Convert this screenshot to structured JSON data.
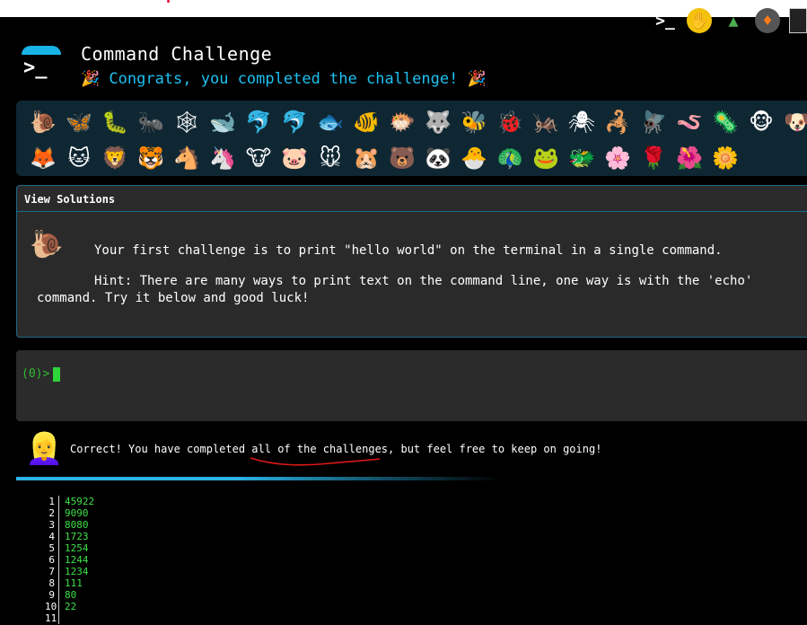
{
  "header": {
    "title": "Command Challenge",
    "subtitle": "🎉 Congrats, you completed the challenge! 🎉"
  },
  "top_icons": [
    "terminal-icon",
    "hand-icon",
    "tree-icon",
    "flame-icon",
    "image-icon"
  ],
  "emoji_rows": [
    [
      "🐌",
      "🦋",
      "🐛",
      "🐜",
      "🕸",
      "🐋",
      "🐬",
      "🐬",
      "🐟",
      "🐠",
      "🐡",
      "🐺",
      "🐝",
      "🐞",
      "🦗",
      "🕷",
      "🦂",
      "🪰",
      "🪱",
      "🦠",
      "🐵",
      "🐶"
    ],
    [
      "🦊",
      "🐱",
      "🦁",
      "🐯",
      "🐴",
      "🦄",
      "🐮",
      "🐷",
      "🐭",
      "🐹",
      "🐻",
      "🐼",
      "🐣",
      "🦚",
      "🐸",
      "🐲",
      "🌸",
      "🌹",
      "🌺",
      "🌼"
    ]
  ],
  "solutions": {
    "title": "View Solutions",
    "icon": "🐌",
    "challenge": "Your first challenge is to print \"hello world\" on the terminal in a single command.",
    "hint": "Hint: There are many ways to print text on the command line, one way is with the 'echo' command. Try it below and good luck!"
  },
  "terminal": {
    "prompt": "(0)>"
  },
  "result": {
    "avatar": "👱‍♀️",
    "message_before": "Correct! You have completed ",
    "message_emph": "all of the challenges",
    "message_after": ", but feel free to keep on going!"
  },
  "history": [
    {
      "n": "1",
      "v": "45922"
    },
    {
      "n": "2",
      "v": "9090"
    },
    {
      "n": "3",
      "v": "8080"
    },
    {
      "n": "4",
      "v": "1723"
    },
    {
      "n": "5",
      "v": "1254"
    },
    {
      "n": "6",
      "v": "1244"
    },
    {
      "n": "7",
      "v": "1234"
    },
    {
      "n": "8",
      "v": "111"
    },
    {
      "n": "9",
      "v": "80"
    },
    {
      "n": "10",
      "v": "22"
    },
    {
      "n": "11",
      "v": ""
    }
  ]
}
